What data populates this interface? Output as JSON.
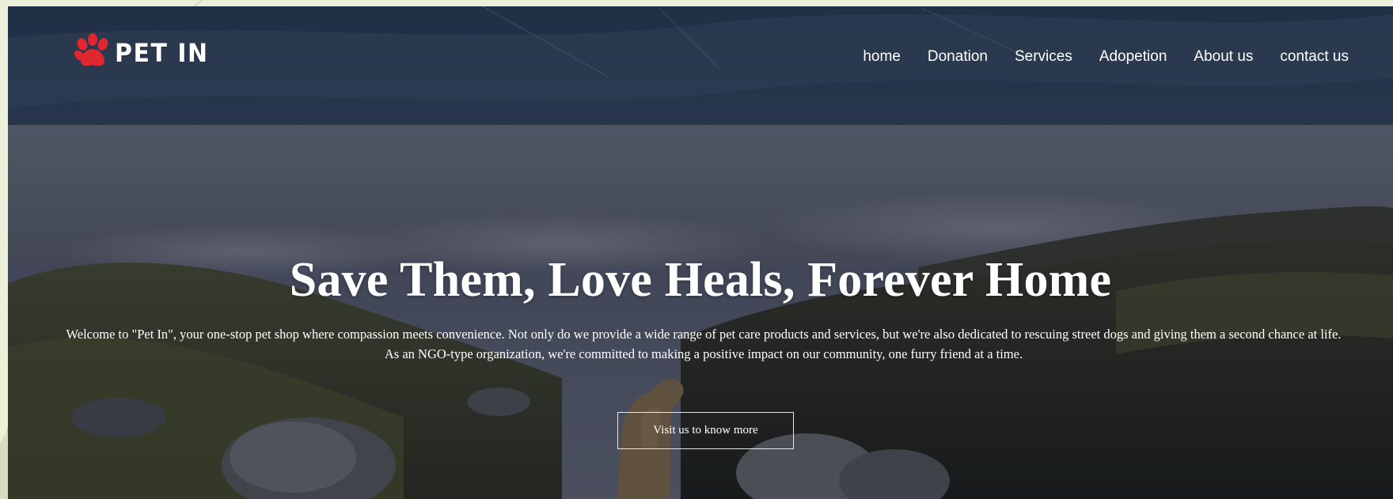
{
  "brand": {
    "name": "PET IN",
    "logo_icon": "paw-icon",
    "logo_color": "#e0262f"
  },
  "nav": {
    "items": [
      {
        "label": "home"
      },
      {
        "label": "Donation"
      },
      {
        "label": "Services"
      },
      {
        "label": "Adopetion"
      },
      {
        "label": "About us"
      },
      {
        "label": "contact us"
      }
    ]
  },
  "hero": {
    "headline": "Save Them, Love Heals, Forever Home",
    "intro": "Welcome to \"Pet In\", your one-stop pet shop where compassion meets convenience. Not only do we provide a wide range of pet care products and services, but we're also dedicated to rescuing street dogs and giving them a second chance at life. As an NGO-type organization, we're committed to making a positive impact on our community, one furry friend at a time.",
    "cta_label": "Visit us to know more"
  },
  "colors": {
    "frame": "#edf0d8",
    "text": "#ffffff",
    "accent": "#e0262f"
  }
}
